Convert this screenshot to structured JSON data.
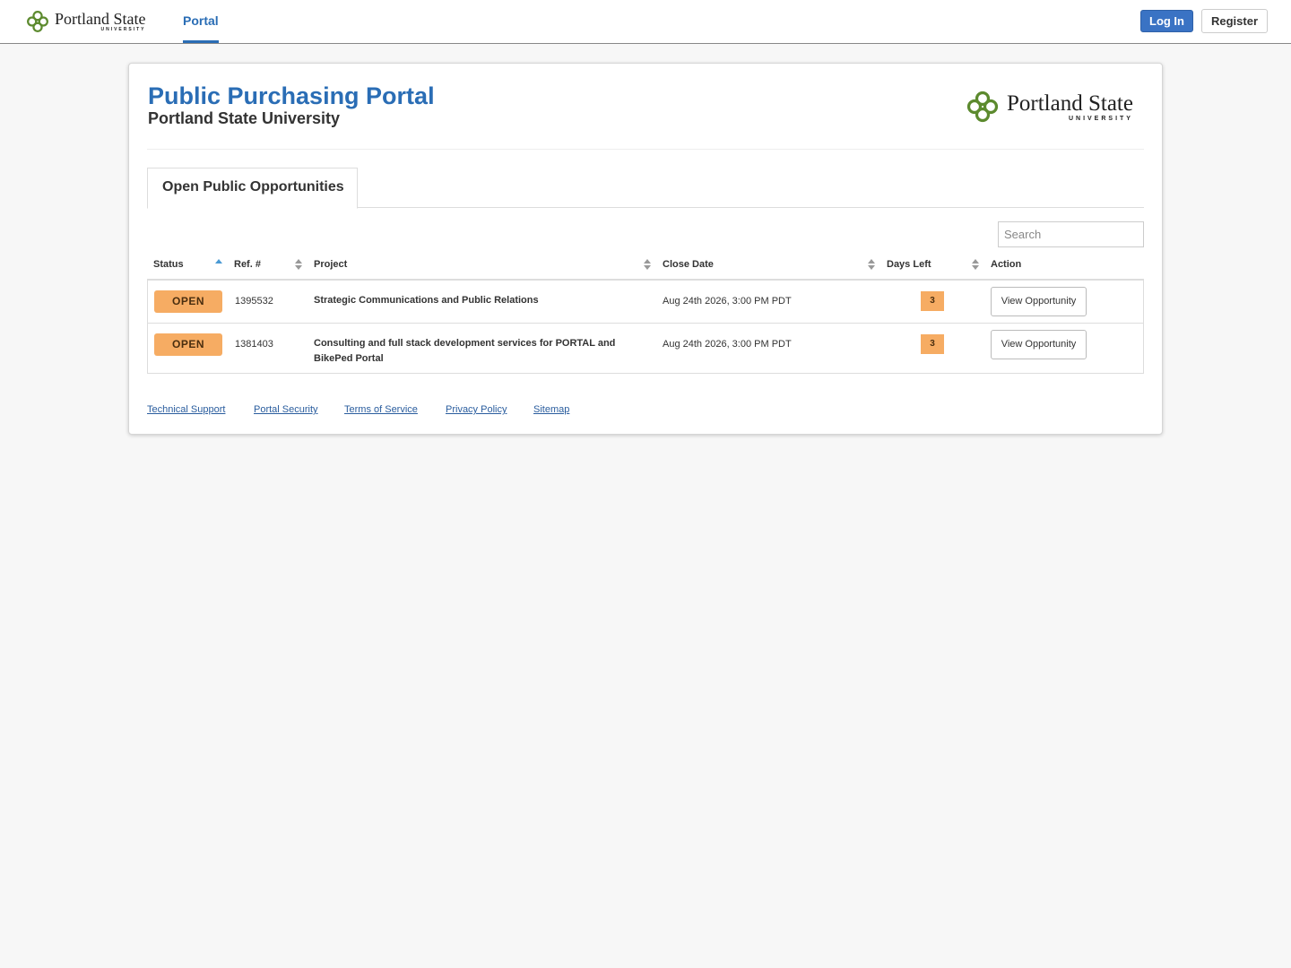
{
  "nav": {
    "logo_name": "Portland State",
    "logo_sub": "UNIVERSITY",
    "tab_label": "Portal",
    "login_label": "Log In",
    "register_label": "Register"
  },
  "header": {
    "title": "Public Purchasing Portal",
    "subtitle": "Portland State University",
    "logo_name": "Portland State",
    "logo_sub": "UNIVERSITY"
  },
  "tabs": [
    {
      "label": "Open Public Opportunities",
      "active": true
    }
  ],
  "search": {
    "placeholder": "Search"
  },
  "table": {
    "columns": [
      "Status",
      "Ref. #",
      "Project",
      "Close Date",
      "Days Left",
      "Action"
    ],
    "rows": [
      {
        "status": "OPEN",
        "ref": "1395532",
        "project": "Strategic Communications and Public Relations",
        "close_date": "Aug 24th 2026, 3:00 PM PDT",
        "days_left": "3",
        "action": "View Opportunity"
      },
      {
        "status": "OPEN",
        "ref": "1381403",
        "project": "Consulting and full stack development services for PORTAL and BikePed Portal",
        "close_date": "Aug 24th 2026, 3:00 PM PDT",
        "days_left": "3",
        "action": "View Opportunity"
      }
    ]
  },
  "footer": {
    "links": [
      "Technical Support",
      "Portal Security",
      "Terms of Service",
      "Privacy Policy",
      "Sitemap"
    ]
  },
  "colors": {
    "brand_blue": "#2a6db5",
    "logo_green": "#5c8a2e",
    "status_orange": "#f6ac63"
  }
}
